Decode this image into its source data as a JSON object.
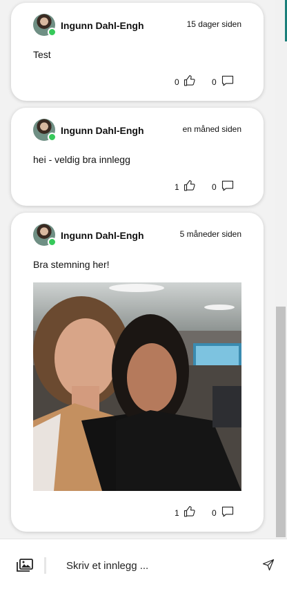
{
  "posts": [
    {
      "author": "Ingunn Dahl-Engh",
      "time": "15 dager siden",
      "text": "Test",
      "likes": "0",
      "comments": "0"
    },
    {
      "author": "Ingunn Dahl-Engh",
      "time": "en måned siden",
      "text": "hei - veldig bra innlegg",
      "likes": "1",
      "comments": "0"
    },
    {
      "author": "Ingunn Dahl-Engh",
      "time": "5 måneder siden",
      "text": "Bra stemning her!",
      "likes": "1",
      "comments": "0"
    }
  ],
  "composer": {
    "placeholder": "Skriv et innlegg ..."
  },
  "icons": {
    "like": "thumbs-up-icon",
    "comment": "comment-icon",
    "gallery": "image-gallery-icon",
    "send": "send-icon"
  },
  "colors": {
    "online": "#36c95a",
    "card": "#ffffff",
    "background": "#f2f2f2"
  }
}
